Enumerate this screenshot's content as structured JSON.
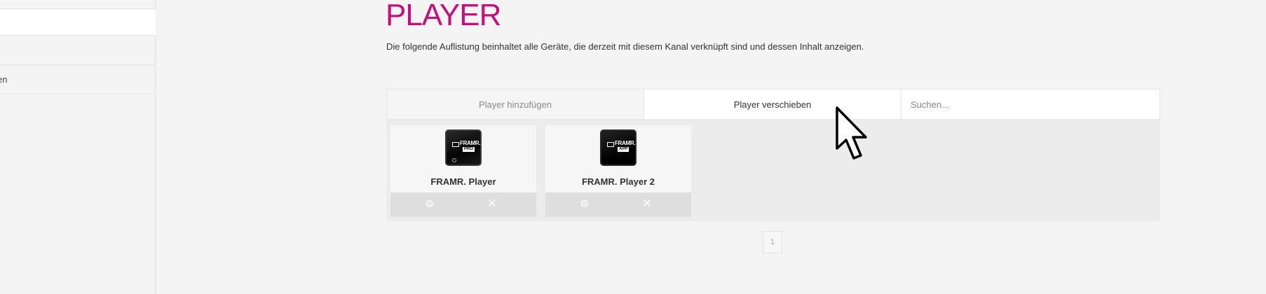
{
  "sidebar": {
    "items": [
      {
        "label": ""
      },
      {
        "label": ""
      },
      {
        "label": "en"
      }
    ]
  },
  "page": {
    "title": "PLAYER",
    "description": "Die folgende Auflistung beinhaltet alle Geräte, die derzeit mit diesem Kanal verknüpft sind und dessen Inhalt anzeigen."
  },
  "toolbar": {
    "add_label": "Player hinzufügen",
    "move_label": "Player verschieben",
    "search_placeholder": "Suchen..."
  },
  "players": [
    {
      "name": "FRAMR. Player",
      "brand": "FRAMR.",
      "tag": "PRO",
      "icon": "framr-player-icon"
    },
    {
      "name": "FRAMR. Player 2",
      "brand": "FRAMR.",
      "tag": "APP",
      "icon": "framr-app-icon"
    }
  ],
  "card_actions": {
    "settings_icon": "gear-icon",
    "remove_icon": "close-icon"
  },
  "pagination": {
    "current_page": "1"
  },
  "colors": {
    "accent": "#c0127a",
    "background": "#f4f4f4",
    "grid_background": "#ececec",
    "action_bar": "#dedede"
  }
}
